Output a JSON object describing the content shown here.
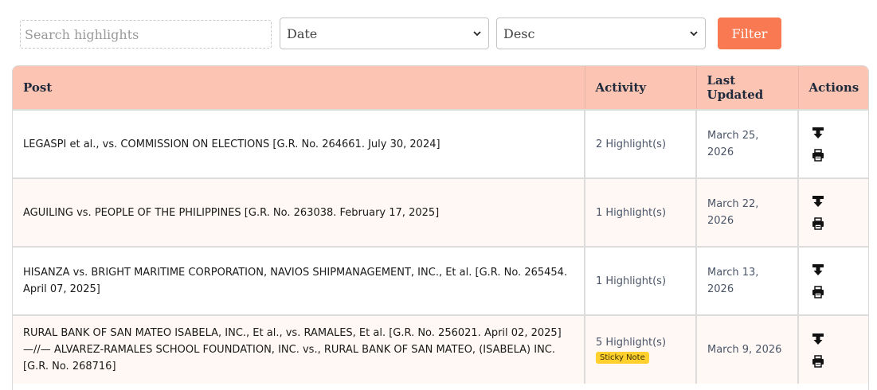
{
  "filters": {
    "search_placeholder": "Search highlights",
    "sort_field": "Date",
    "sort_order": "Desc",
    "filter_label": "Filter"
  },
  "table": {
    "headers": {
      "post": "Post",
      "activity": "Activity",
      "updated": "Last Updated",
      "actions": "Actions"
    },
    "rows": [
      {
        "post": "LEGASPI et al., vs. COMMISSION ON ELECTIONS [G.R. No. 264661. July 30, 2024]",
        "activity": "2 Highlight(s)",
        "updated": "March 25, 2026"
      },
      {
        "post": "AGUILING vs. PEOPLE OF THE PHILIPPINES [G.R. No. 263038. February 17, 2025]",
        "activity": "1 Highlight(s)",
        "updated": "March 22, 2026"
      },
      {
        "post": "HISANZA vs. BRIGHT MARITIME CORPORATION, NAVIOS SHIPMANAGEMENT, INC., Et al. [G.R. No. 265454. April 07, 2025]",
        "activity": "1 Highlight(s)",
        "updated": "March 13, 2026"
      },
      {
        "post": "RURAL BANK OF SAN MATEO ISABELA, INC., Et al., vs. RAMALES, Et al. [G.R. No. 256021. April 02, 2025] —//— ALVAREZ-RAMALES SCHOOL FOUNDATION, INC. vs., RURAL BANK OF SAN MATEO, (ISABELA) INC. [G.R. No. 268716]",
        "activity": "5 Highlight(s)",
        "badge": "Sticky Note",
        "updated": "March 9, 2026"
      }
    ]
  },
  "icons": {
    "download": "download-icon",
    "print": "print-icon",
    "chevron": "chevron-down-icon"
  },
  "colors": {
    "accent": "#f97a52",
    "header_bg": "#fcc4b2",
    "row_alt": "#fff8f4",
    "badge": "#ffd02e"
  }
}
